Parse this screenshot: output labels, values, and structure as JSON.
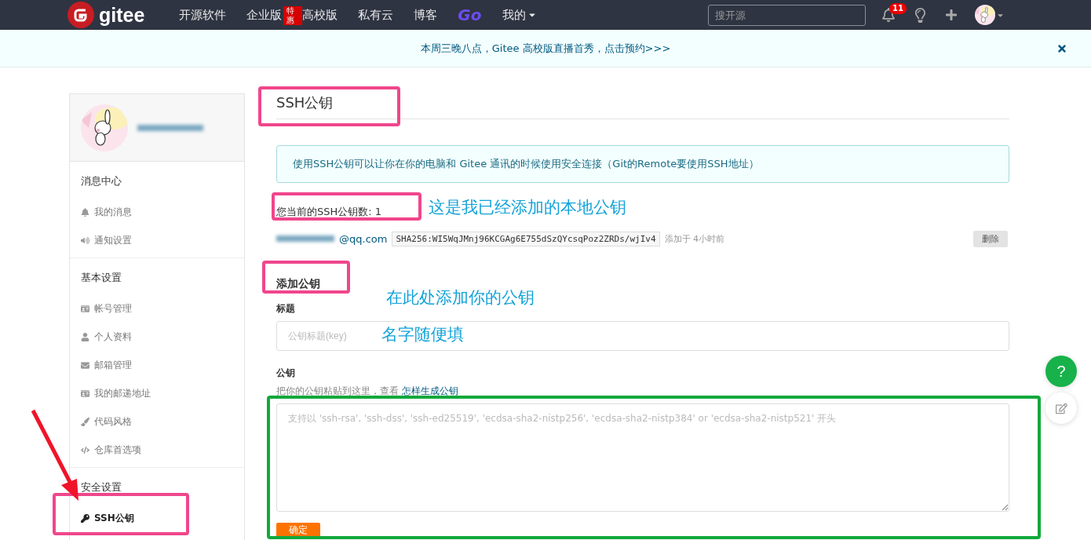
{
  "navbar": {
    "logo": "gitee",
    "items": [
      {
        "label": "开源软件"
      },
      {
        "label": "企业版",
        "badge": "特惠"
      },
      {
        "label": "高校版"
      },
      {
        "label": "私有云"
      },
      {
        "label": "博客"
      },
      {
        "label": "Go",
        "kind": "brand"
      },
      {
        "label": "我的",
        "kind": "dropdown"
      }
    ],
    "search": {
      "placeholder": "搜开源"
    },
    "notification_count": "11"
  },
  "banner": {
    "text": "本周三晚八点，Gitee 高校版直播首秀，点击预约>>>"
  },
  "sidebar": {
    "sections": [
      {
        "title": "消息中心",
        "items": [
          {
            "label": "我的消息",
            "selected": false
          },
          {
            "label": "通知设置",
            "selected": false
          }
        ]
      },
      {
        "title": "基本设置",
        "items": [
          {
            "label": "帐号管理",
            "selected": false
          },
          {
            "label": "个人资料",
            "selected": false
          },
          {
            "label": "邮箱管理",
            "selected": false
          },
          {
            "label": "我的邮递地址",
            "selected": false
          },
          {
            "label": "代码风格",
            "selected": false
          },
          {
            "label": "仓库首选项",
            "selected": false
          }
        ]
      },
      {
        "title": "安全设置",
        "items": [
          {
            "label": "SSH公钥",
            "selected": true
          }
        ]
      }
    ]
  },
  "content": {
    "title": "SSH公钥",
    "notice": "使用SSH公钥可以让你在你的电脑和 Gitee 通讯的时候使用安全连接（Git的Remote要使用SSH地址）",
    "key_count": "您当前的SSH公钥数: 1",
    "keys": [
      {
        "email": "@qq.com",
        "fingerprint": "SHA256:WI5WqJMnj96KCGAg6E755dSzQYcsqPoz2ZRDs/wjIv4",
        "added": "添加于 4小时前",
        "action": "删除"
      }
    ],
    "add_title": "添加公钥",
    "title_label": "标题",
    "title_field": {
      "placeholder": "公钥标题(key)"
    },
    "key_label": "公钥",
    "key_help": "把你的公钥粘贴到这里，查看 ",
    "key_help_link": "怎样生成公钥",
    "key_field": {
      "placeholder": "支持以 'ssh-rsa', 'ssh-dss', 'ssh-ed25519', 'ecdsa-sha2-nistp256', 'ecdsa-sha2-nistp384' or 'ecdsa-sha2-nistp521' 开头"
    },
    "submit": "确定"
  },
  "floating": {
    "help": "?"
  },
  "annotations": [
    "这是我已经添加的本地公钥",
    "在此处添加你的公钥",
    "名字随便填"
  ]
}
